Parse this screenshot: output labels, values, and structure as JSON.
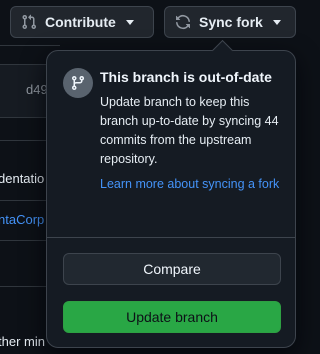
{
  "toolbar": {
    "contribute_label": "Contribute",
    "sync_fork_label": "Sync fork"
  },
  "background": {
    "commit_hash_fragment": "d49",
    "row_1_fragment": "dentatio",
    "row_2_fragment": "ntaCorp",
    "row_3_fragment": "ther min"
  },
  "popover": {
    "title": "This branch is out-of-date",
    "description": "Update branch to keep this branch up-to-date by syncing 44 commits from the upstream repository.",
    "learn_more_link": "Learn more about syncing a fork",
    "compare_button": "Compare",
    "update_button": "Update branch"
  },
  "colors": {
    "accent_link": "#4493f8",
    "update_button": "#29a745",
    "background": "#0d1117"
  },
  "icons": {
    "contribute": "git-pull-request-icon",
    "sync_fork": "sync-icon",
    "popover": "git-branch-icon"
  }
}
